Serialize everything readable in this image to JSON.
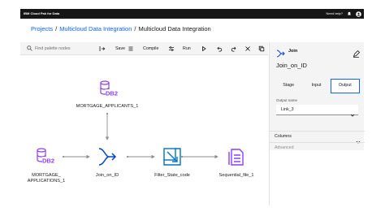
{
  "topbar": {
    "app_title": "IBM Cloud Pak for Data",
    "help": "Need help?"
  },
  "breadcrumb": {
    "projects": "Projects",
    "project": "Multicloud Data Integration",
    "current": "Multicloud Data Integration",
    "separator": "/"
  },
  "toolbar": {
    "search_placeholder": "Find palette nodes",
    "save": "Save",
    "compile": "Compile",
    "run": "Run"
  },
  "nodes": {
    "db2_top": {
      "icon_text": "DB2",
      "label": "MORTGAGE_APPLICANTS_1"
    },
    "db2_left": {
      "icon_text": "DB2",
      "label_line1": "MORTGAGE_",
      "label_line2": "APPLICATIONS_1"
    },
    "join": {
      "label": "Join_on_ID"
    },
    "filter": {
      "label": "Filter_State_code"
    },
    "seq": {
      "label": "Sequential_file_1"
    }
  },
  "panel": {
    "title": "Join",
    "name": "Join_on_ID",
    "tabs": [
      "Stage",
      "Input",
      "Output"
    ],
    "active_tab": "Output",
    "output_name_label": "Output name",
    "output_name_value": "Link_3",
    "columns": "Columns",
    "advanced": "Advanced"
  },
  "colors": {
    "accent": "#0f62fe",
    "db2": "#8a3ffc",
    "join": "#0043ce",
    "filter": "#0072c3",
    "seq": "#8a3ffc"
  }
}
